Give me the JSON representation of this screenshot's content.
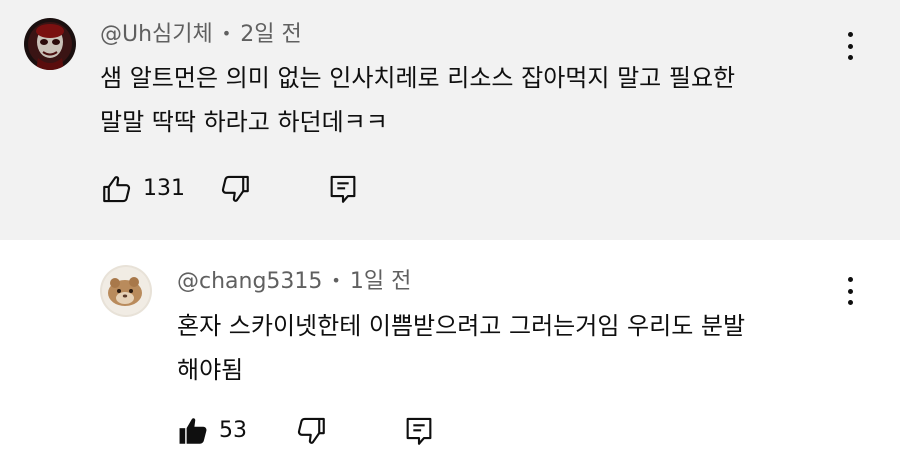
{
  "comments": [
    {
      "author": "@Uh심기체",
      "time": "2일 전",
      "text_lines": [
        "샘 알트먼은 의미 없는 인사치레로 리소스 잡아먹지 말고 필요한",
        "말말 딱딱 하라고 하던데ㅋㅋ"
      ],
      "likes": "131",
      "liked": false
    },
    {
      "author": "@chang5315",
      "time": "1일 전",
      "text_lines": [
        "혼자 스카이넷한테 이쁨받으려고 그러는거임 우리도 분발",
        "해야됨"
      ],
      "likes": "53",
      "liked": true
    }
  ],
  "icons": {
    "like": "thumbs-up-icon",
    "dislike": "thumbs-down-icon",
    "reply": "reply-icon",
    "menu": "more-vert-icon"
  },
  "colors": {
    "highlight_bg": "#f2f2f2",
    "meta_text": "#606060",
    "text": "#0f0f0f"
  }
}
